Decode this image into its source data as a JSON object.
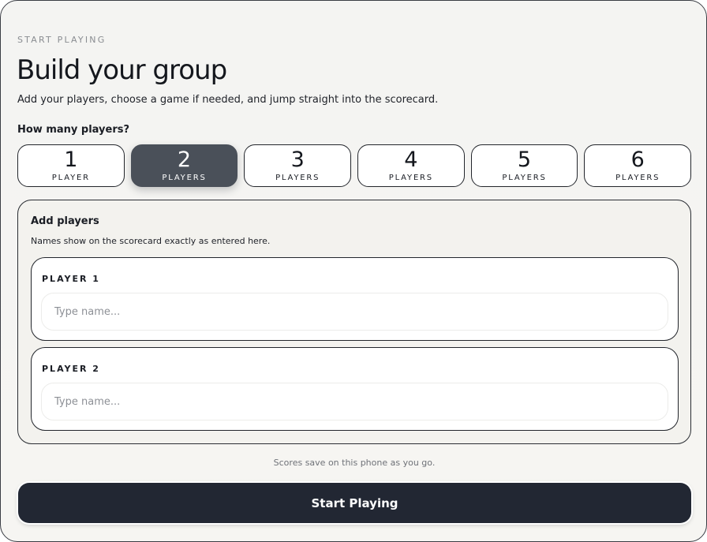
{
  "header": {
    "eyebrow": "START PLAYING",
    "title": "Build your group",
    "subtitle": "Add your players, choose a game if needed, and jump straight into the scorecard."
  },
  "player_count": {
    "label": "How many players?",
    "selected": 2,
    "options": [
      {
        "number": "1",
        "unit": "PLAYER"
      },
      {
        "number": "2",
        "unit": "PLAYERS"
      },
      {
        "number": "3",
        "unit": "PLAYERS"
      },
      {
        "number": "4",
        "unit": "PLAYERS"
      },
      {
        "number": "5",
        "unit": "PLAYERS"
      },
      {
        "number": "6",
        "unit": "PLAYERS"
      }
    ]
  },
  "players_panel": {
    "title": "Add players",
    "note": "Names show on the scorecard exactly as entered here.",
    "players": [
      {
        "label": "PLAYER 1",
        "value": "",
        "placeholder": "Type name..."
      },
      {
        "label": "PLAYER 2",
        "value": "",
        "placeholder": "Type name..."
      }
    ]
  },
  "footer": {
    "note": "Scores save on this phone as you go.",
    "start_label": "Start Playing"
  },
  "colors": {
    "selected": "#4a5059",
    "primary_button": "#222733",
    "background": "#f4f4f2"
  }
}
